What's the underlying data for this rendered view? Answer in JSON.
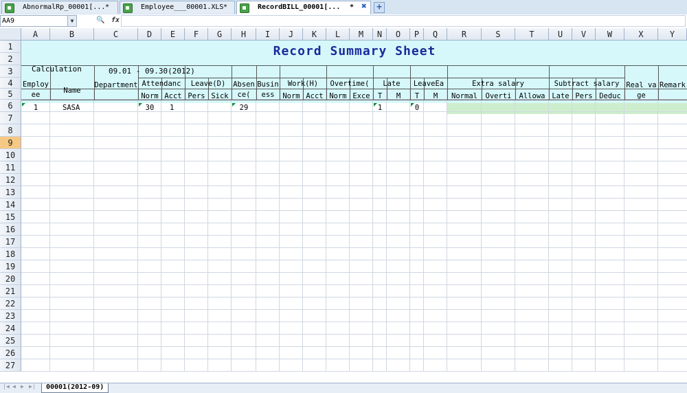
{
  "file_tabs": [
    {
      "label": "AbnormalRp_00001[...",
      "star": "*"
    },
    {
      "label": "Employee___00001.XLS",
      "star": "*"
    },
    {
      "label": "RecordBILL_00001[...",
      "star": "*"
    }
  ],
  "name_box": "AA9",
  "fx_label": "fx",
  "columns": [
    "A",
    "B",
    "C",
    "D",
    "E",
    "F",
    "G",
    "H",
    "I",
    "J",
    "K",
    "L",
    "M",
    "N",
    "O",
    "P",
    "Q",
    "R",
    "S",
    "T",
    "U",
    "V",
    "W",
    "X",
    "Y"
  ],
  "rows": [
    "1",
    "2",
    "3",
    "4",
    "5",
    "6",
    "7",
    "8",
    "9",
    "10",
    "11",
    "12",
    "13",
    "14",
    "15",
    "16",
    "17",
    "18",
    "19",
    "20",
    "21",
    "22",
    "23",
    "24",
    "25",
    "26",
    "27"
  ],
  "selected_row": "9",
  "sheet": {
    "title": "Record Summary Sheet",
    "calc_label": "Calculation Date",
    "date_range": "09.01 - 09.30(2012)",
    "headers": {
      "employee": "Employee",
      "name": "Name",
      "department": "Department",
      "attendance": "Attendanc",
      "leave": "Leave(D)",
      "absence": "Absence(",
      "business": "Business",
      "work": "Work(H)",
      "overtime": "Overtime(",
      "late": "Late",
      "leave_early": "LeaveEa",
      "extra_salary": "Extra salary",
      "subtract_salary": "Subtract salary",
      "real_wage": "Real vage",
      "remark": "Remark"
    },
    "subheaders": {
      "att_norm": "Norm",
      "att_acct": "Acct",
      "leave_pers": "Pers",
      "leave_sick": "Sick",
      "work_norm": "Norm",
      "work_acct": "Acct",
      "ot_norm": "Norm",
      "ot_exce": "Exce",
      "late_t": "T",
      "late_m": "M",
      "le_t": "T",
      "le_m": "M",
      "ex_normal": "Normal",
      "ex_overti": "Overti",
      "ex_allowa": "Allowa",
      "sub_late": "Late",
      "sub_pers": "Pers",
      "sub_deduc": "Deduc"
    },
    "row5": {
      "employee": "1",
      "name": "SASA",
      "att_norm": "30",
      "att_acct": "1",
      "absence": "29",
      "late_t": "1",
      "le_t": "0"
    }
  },
  "sheet_tab": "00001(2012-09)",
  "colors": {
    "header_band": "#d6f8fb",
    "title": "#1a2a9a",
    "salary_band": "#cdeecd",
    "selected_row": "#f6c884"
  }
}
